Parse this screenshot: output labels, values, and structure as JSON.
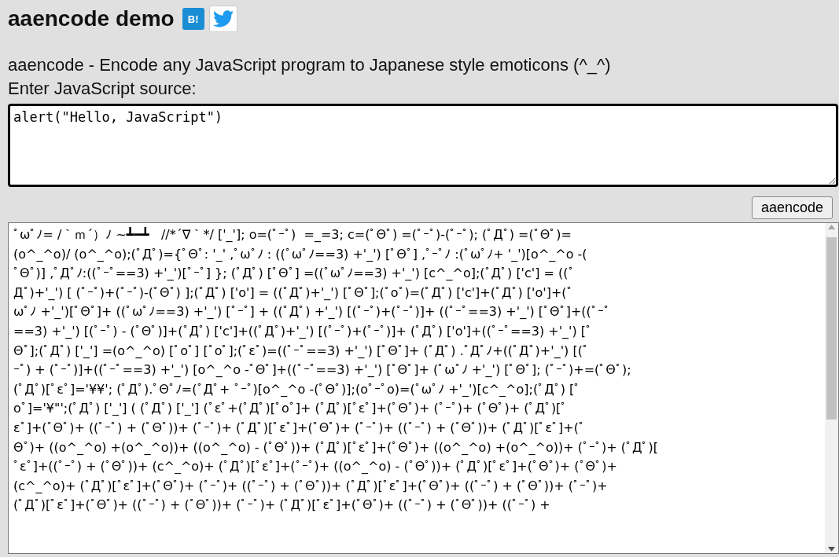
{
  "header": {
    "title": "aaencode demo",
    "share_buttons": [
      {
        "kind": "hatena",
        "label": "B!"
      },
      {
        "kind": "twitter"
      }
    ]
  },
  "description": "aaencode - Encode any JavaScript program to Japanese style emoticons (^_^)",
  "source": {
    "label": "Enter JavaScript source:",
    "value": "alert(\"Hello, JavaScript\")"
  },
  "encode_button": "aaencode",
  "output": {
    "lines": [
      "ﾟωﾟﾉ= /｀ｍ´）ﾉ ~┻━┻   //*´∇｀*/ ['_']; o=(ﾟｰﾟ)  =_=3; c=(ﾟΘﾟ) =(ﾟｰﾟ)-(ﾟｰﾟ); (ﾟДﾟ) =(ﾟΘﾟ)=",
      "(o^_^o)/ (o^_^o);(ﾟДﾟ)={ﾟΘﾟ: '_' ,ﾟωﾟﾉ : ((ﾟωﾟﾉ==3) +'_') [ﾟΘﾟ] ,ﾟｰﾟﾉ :(ﾟωﾟﾉ+ '_')[o^_^o -(",
      "ﾟΘﾟ)] ,ﾟДﾟﾉ:((ﾟｰﾟ==3) +'_')[ﾟｰﾟ] }; (ﾟДﾟ) [ﾟΘﾟ] =((ﾟωﾟﾉ==3) +'_') [c^_^o];(ﾟДﾟ) ['c'] = ((ﾟ",
      "Дﾟ)+'_') [ (ﾟｰﾟ)+(ﾟｰﾟ)-(ﾟΘﾟ) ];(ﾟДﾟ) ['o'] = ((ﾟДﾟ)+'_') [ﾟΘﾟ];(ﾟoﾟ)=(ﾟДﾟ) ['c']+(ﾟДﾟ) ['o']+(ﾟ",
      "ωﾟﾉ +'_')[ﾟΘﾟ]+ ((ﾟωﾟﾉ==3) +'_') [ﾟｰﾟ] + ((ﾟДﾟ) +'_') [(ﾟｰﾟ)+(ﾟｰﾟ)]+ ((ﾟｰﾟ==3) +'_') [ﾟΘﾟ]+((ﾟｰﾟ",
      "==3) +'_') [(ﾟｰﾟ) - (ﾟΘﾟ)]+(ﾟДﾟ) ['c']+((ﾟДﾟ)+'_') [(ﾟｰﾟ)+(ﾟｰﾟ)]+ (ﾟДﾟ) ['o']+((ﾟｰﾟ==3) +'_') [ﾟ",
      "Θﾟ];(ﾟДﾟ) ['_'] =(o^_^o) [ﾟoﾟ] [ﾟoﾟ];(ﾟεﾟ)=((ﾟｰﾟ==3) +'_') [ﾟΘﾟ]+ (ﾟДﾟ) .ﾟДﾟﾉ+((ﾟДﾟ)+'_') [(ﾟ",
      "ｰﾟ) + (ﾟｰﾟ)]+((ﾟｰﾟ==3) +'_') [o^_^o -ﾟΘﾟ]+((ﾟｰﾟ==3) +'_') [ﾟΘﾟ]+ (ﾟωﾟﾉ +'_') [ﾟΘﾟ]; (ﾟｰﾟ)+=(ﾟΘﾟ);",
      "(ﾟДﾟ)[ﾟεﾟ]='¥¥'; (ﾟДﾟ).ﾟΘﾟﾉ=(ﾟДﾟ+ ﾟｰﾟ)[o^_^o -(ﾟΘﾟ)];(oﾟｰﾟo)=(ﾟωﾟﾉ +'_')[c^_^o];(ﾟДﾟ) [ﾟ",
      "oﾟ]='¥\"';(ﾟДﾟ) ['_'] ( (ﾟДﾟ) ['_'] (ﾟεﾟ+(ﾟДﾟ)[ﾟoﾟ]+ (ﾟДﾟ)[ﾟεﾟ]+(ﾟΘﾟ)+ (ﾟｰﾟ)+ (ﾟΘﾟ)+ (ﾟДﾟ)[ﾟ",
      "εﾟ]+(ﾟΘﾟ)+ ((ﾟｰﾟ) + (ﾟΘﾟ))+ (ﾟｰﾟ)+ (ﾟДﾟ)[ﾟεﾟ]+(ﾟΘﾟ)+ (ﾟｰﾟ)+ ((ﾟｰﾟ) + (ﾟΘﾟ))+ (ﾟДﾟ)[ﾟεﾟ]+(ﾟ",
      "Θﾟ)+ ((o^_^o) +(o^_^o))+ ((o^_^o) - (ﾟΘﾟ))+ (ﾟДﾟ)[ﾟεﾟ]+(ﾟΘﾟ)+ ((o^_^o) +(o^_^o))+ (ﾟｰﾟ)+ (ﾟДﾟ)[",
      "ﾟεﾟ]+((ﾟｰﾟ) + (ﾟΘﾟ))+ (c^_^o)+ (ﾟДﾟ)[ﾟεﾟ]+(ﾟｰﾟ)+ ((o^_^o) - (ﾟΘﾟ))+ (ﾟДﾟ)[ﾟεﾟ]+(ﾟΘﾟ)+ (ﾟΘﾟ)+",
      "(c^_^o)+ (ﾟДﾟ)[ﾟεﾟ]+(ﾟΘﾟ)+ (ﾟｰﾟ)+ ((ﾟｰﾟ) + (ﾟΘﾟ))+ (ﾟДﾟ)[ﾟεﾟ]+(ﾟΘﾟ)+ ((ﾟｰﾟ) + (ﾟΘﾟ))+ (ﾟｰﾟ)+",
      "(ﾟДﾟ)[ﾟεﾟ]+(ﾟΘﾟ)+ ((ﾟｰﾟ) + (ﾟΘﾟ))+ (ﾟｰﾟ)+ (ﾟДﾟ)[ﾟεﾟ]+(ﾟΘﾟ)+ ((ﾟｰﾟ) + (ﾟΘﾟ))+ ((ﾟｰﾟ) +"
    ]
  }
}
